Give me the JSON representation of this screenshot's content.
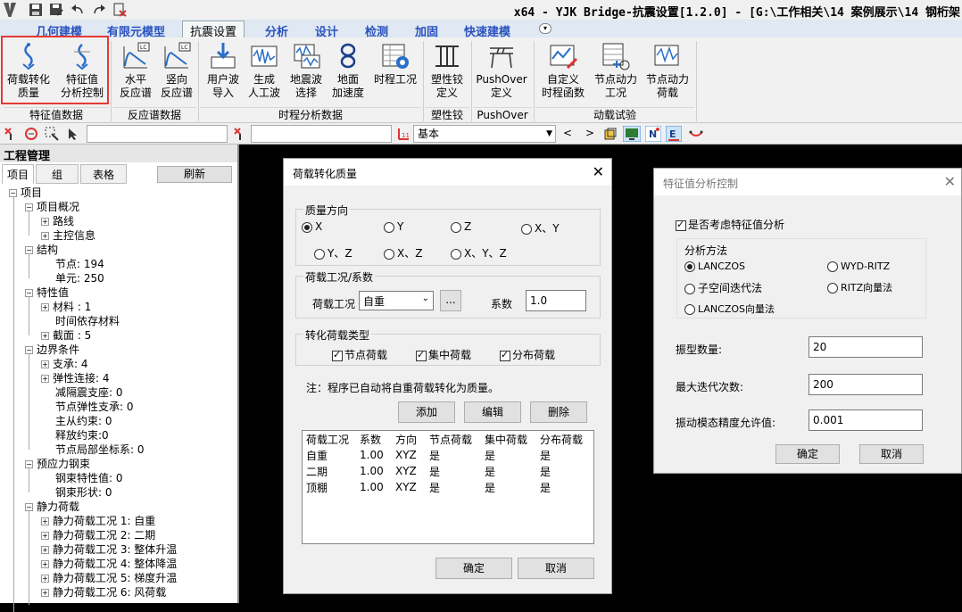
{
  "titlebar": {
    "title": "x64 - YJK Bridge-抗震设置[1.2.0] - [G:\\工作相关\\14 案例展示\\14 钢桁架"
  },
  "menubar": {
    "items": [
      "几何建模",
      "有限元模型",
      "抗震设置",
      "分析",
      "设计",
      "检测",
      "加固",
      "快速建模"
    ],
    "active_index": 2
  },
  "ribbon": {
    "buttons": [
      {
        "label1": "荷载转化",
        "label2": "质量"
      },
      {
        "label1": "特征值",
        "label2": "分析控制"
      },
      {
        "label1": "水平",
        "label2": "反应谱"
      },
      {
        "label1": "竖向",
        "label2": "反应谱"
      },
      {
        "label1": "用户波",
        "label2": "导入"
      },
      {
        "label1": "生成",
        "label2": "人工波"
      },
      {
        "label1": "地震波",
        "label2": "选择"
      },
      {
        "label1": "地面",
        "label2": "加速度"
      },
      {
        "label1": "时程工况",
        "label2": ""
      },
      {
        "label1": "塑性铰",
        "label2": "定义"
      },
      {
        "label1": "PushOver",
        "label2": "定义"
      },
      {
        "label1": "自定义",
        "label2": "时程函数"
      },
      {
        "label1": "节点动力",
        "label2": "工况"
      },
      {
        "label1": "节点动力",
        "label2": "荷载"
      }
    ],
    "groups": [
      "特征值数据",
      "反应谱数据",
      "时程分析数据",
      "塑性铰",
      "PushOver",
      "动载试验"
    ]
  },
  "toolbar2": {
    "combo_value": "基本",
    "nav_prev": "<",
    "nav_next": ">"
  },
  "project": {
    "title": "工程管理",
    "tabs": [
      "项目",
      "组",
      "表格"
    ],
    "refresh": "刷新",
    "tree": [
      "项目",
      "项目概况",
      "路线",
      "主控信息",
      "结构",
      "节点: 194",
      "单元: 250",
      "特性值",
      "材料 : 1",
      "时间依存材料",
      "截面 : 5",
      "边界条件",
      "支承: 4",
      "弹性连接: 4",
      "减隔震支座: 0",
      "节点弹性支承: 0",
      "主从约束: 0",
      "释放约束:0",
      "节点局部坐标系: 0",
      "预应力钢束",
      "钢束特性值: 0",
      "钢束形状: 0",
      "静力荷载",
      "静力荷载工况 1: 自重",
      "静力荷载工况 2: 二期",
      "静力荷载工况 3: 整体升温",
      "静力荷载工况 4: 整体降温",
      "静力荷载工况 5: 梯度升温",
      "静力荷载工况 6: 风荷载"
    ]
  },
  "dlg1": {
    "title": "荷载转化质量",
    "dir_title": "质量方向",
    "dirs": [
      "X",
      "Y",
      "Z",
      "X、Y",
      "Y、Z",
      "X、Z",
      "X、Y、Z"
    ],
    "dir_selected": 0,
    "case_title": "荷载工况/系数",
    "case_label": "荷载工况",
    "case_value": "自重",
    "dots": "...",
    "coef_label": "系数",
    "coef_value": "1.0",
    "type_title": "转化荷载类型",
    "types": [
      "节点荷载",
      "集中荷载",
      "分布荷载"
    ],
    "note": "注：程序已自动将自重荷载转化为质量。",
    "btn_add": "添加",
    "btn_edit": "编辑",
    "btn_del": "删除",
    "table_headers": [
      "荷载工况",
      "系数",
      "方向",
      "节点荷载",
      "集中荷载",
      "分布荷载"
    ],
    "table_rows": [
      [
        "自重",
        "1.00",
        "XYZ",
        "是",
        "是",
        "是"
      ],
      [
        "二期",
        "1.00",
        "XYZ",
        "是",
        "是",
        "是"
      ],
      [
        "顶棚",
        "1.00",
        "XYZ",
        "是",
        "是",
        "是"
      ]
    ],
    "ok": "确定",
    "cancel": "取消"
  },
  "dlg2": {
    "title": "特征值分析控制",
    "consider_label": "是否考虑特征值分析",
    "method_title": "分析方法",
    "methods": [
      "LANCZOS",
      "WYD-RITZ",
      "子空间迭代法",
      "RITZ向量法",
      "LANCZOS向量法"
    ],
    "method_selected": 0,
    "modes_label": "振型数量:",
    "modes_value": "20",
    "iter_label": "最大迭代次数:",
    "iter_value": "200",
    "tol_label": "振动模态精度允许值:",
    "tol_value": "0.001",
    "ok": "确定",
    "cancel": "取消"
  },
  "colors": {
    "accent_red": "#e53935",
    "menu_blue": "#2a52be"
  }
}
